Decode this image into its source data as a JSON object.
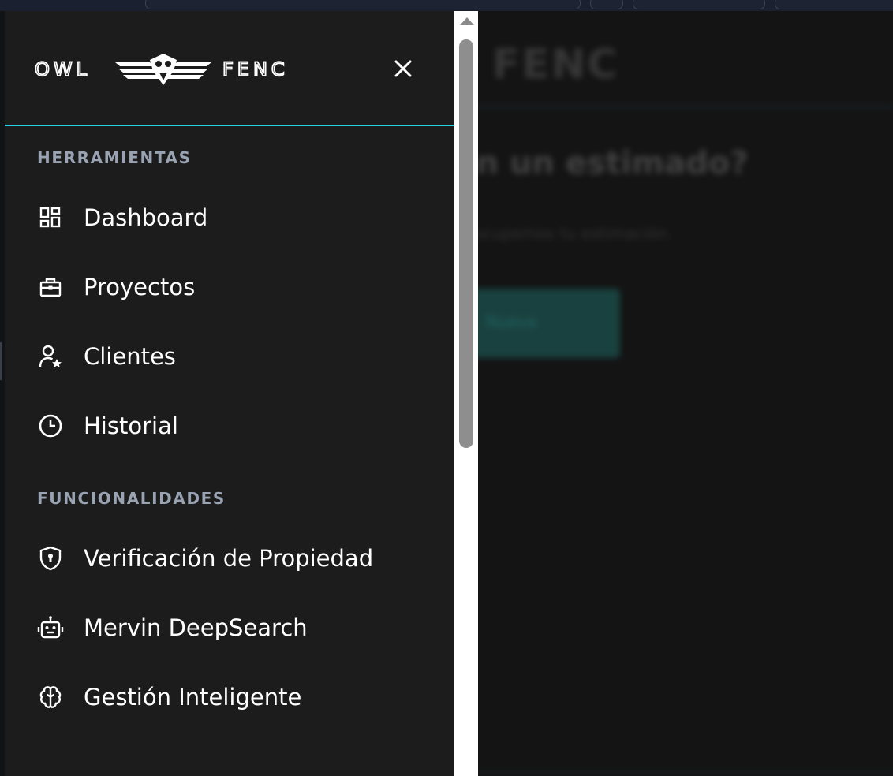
{
  "brand": {
    "left_word": "OWL",
    "right_word": "FENC"
  },
  "background_page": {
    "title_fragment": "r FENC",
    "question_fragment": "on un estimado?",
    "subtitle_fragment": "lo ocupemos tu estimación.",
    "button_fragment": "Nueva"
  },
  "sidebar": {
    "sections": [
      {
        "title": "HERRAMIENTAS",
        "items": [
          {
            "label": "Dashboard",
            "icon": "dashboard-icon"
          },
          {
            "label": "Proyectos",
            "icon": "briefcase-icon"
          },
          {
            "label": "Clientes",
            "icon": "user-star-icon"
          },
          {
            "label": "Historial",
            "icon": "clock-icon"
          }
        ]
      },
      {
        "title": "FUNCIONALIDADES",
        "items": [
          {
            "label": "Verificación de Propiedad",
            "icon": "shield-lock-icon"
          },
          {
            "label": "Mervin DeepSearch",
            "icon": "robot-icon"
          },
          {
            "label": "Gestión Inteligente",
            "icon": "brain-icon"
          }
        ]
      }
    ]
  },
  "colors": {
    "sidebar_bg": "#1c1c1d",
    "accent": "#22d3e6",
    "section_title": "#9aa3b2",
    "text": "#ffffff"
  }
}
